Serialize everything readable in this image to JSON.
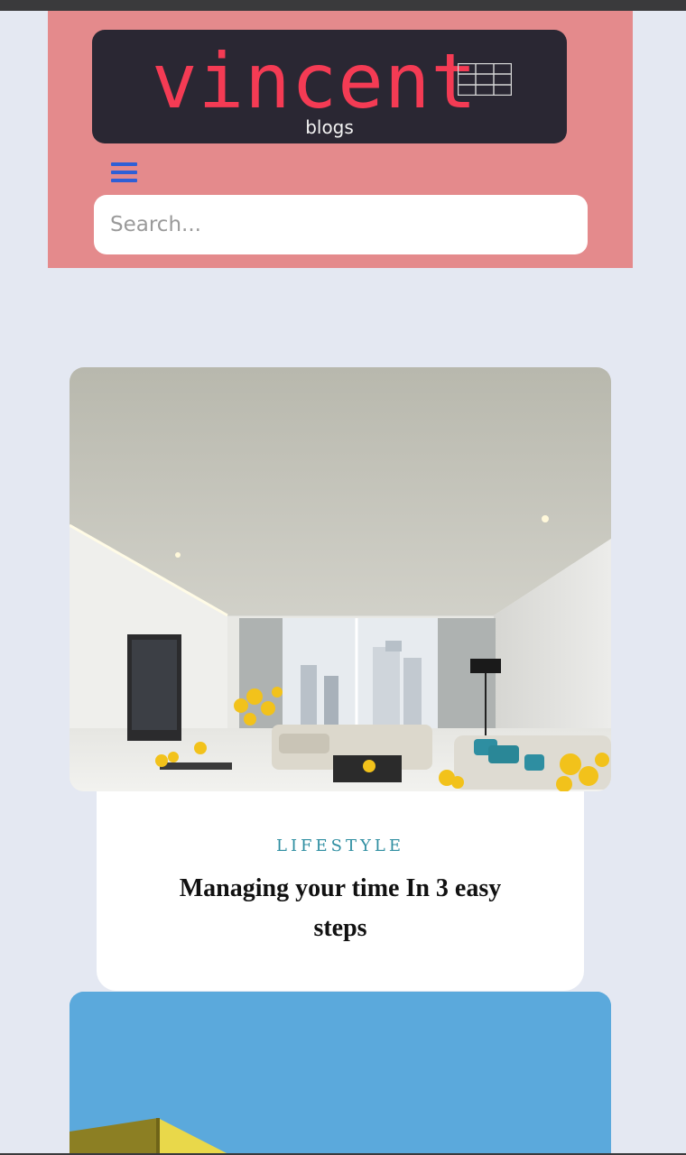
{
  "site": {
    "logo_main": "vincent",
    "logo_sub": "blogs"
  },
  "search": {
    "placeholder": "Search..."
  },
  "posts": [
    {
      "category": "LIFESTYLE",
      "title": "Managing your time In 3 easy steps",
      "image": "living-room-photo"
    },
    {
      "image": "sky-building-photo"
    }
  ],
  "icons": {
    "menu": "hamburger-menu-icon",
    "logo_mark": "grid-icon"
  },
  "colors": {
    "header_bg": "#e48a8c",
    "logo_bg": "#2a2733",
    "logo_text": "#f43b54",
    "menu_icon": "#2f5fd6",
    "category": "#2e8ea1",
    "page_bg": "#e4e8f2",
    "sky": "#5ba9dc"
  }
}
